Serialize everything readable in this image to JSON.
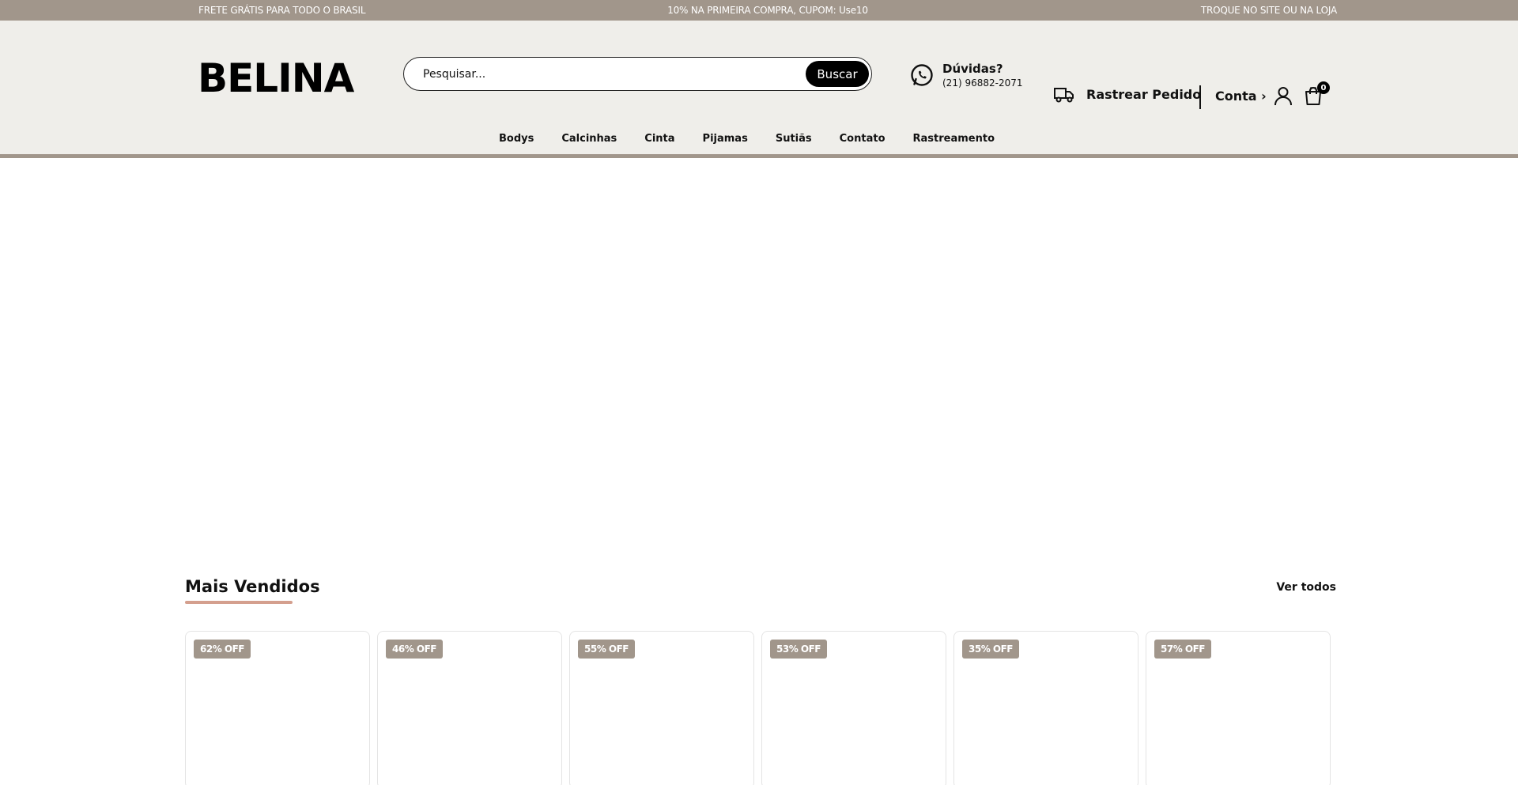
{
  "topbar": {
    "left": "FRETE GRÁTIS PARA TODO O BRASIL",
    "center": "10% NA PRIMEIRA COMPRA, CUPOM: Use10",
    "right": "TROQUE NO SITE OU NA LOJA"
  },
  "header": {
    "logo": "BELINA",
    "search": {
      "placeholder": "Pesquisar...",
      "value": "",
      "button": "Buscar"
    },
    "help": {
      "title": "Dúvidas?",
      "phone": "(21) 96882-2071",
      "icon": "whatsapp-icon"
    },
    "track": {
      "label": "Rastrear Pedido",
      "icon": "truck-icon"
    },
    "account": {
      "label": "Conta ›",
      "icon": "user-icon"
    },
    "cart": {
      "count": "0",
      "icon": "shopping-bag-icon"
    }
  },
  "nav": {
    "items": [
      {
        "label": "Bodys"
      },
      {
        "label": "Calcinhas"
      },
      {
        "label": "Cinta"
      },
      {
        "label": "Pijamas"
      },
      {
        "label": "Sutiãs"
      },
      {
        "label": "Contato"
      },
      {
        "label": "Rastreamento"
      }
    ]
  },
  "best_sellers": {
    "title": "Mais Vendidos",
    "see_all": "Ver todos",
    "products": [
      {
        "badge": "62% OFF"
      },
      {
        "badge": "46% OFF"
      },
      {
        "badge": "55% OFF"
      },
      {
        "badge": "53% OFF"
      },
      {
        "badge": "35% OFF"
      },
      {
        "badge": "57% OFF"
      }
    ]
  },
  "colors": {
    "accent": "#a1968b",
    "header_bg": "#efeeea",
    "underline": "#d49f8e",
    "button": "#000000"
  }
}
